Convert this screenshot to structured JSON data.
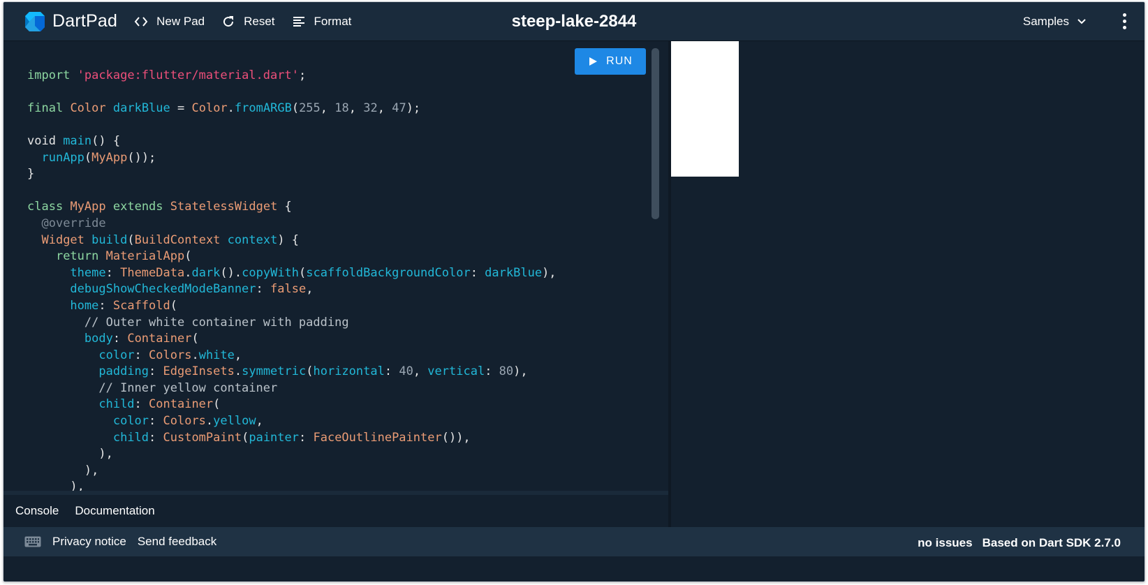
{
  "header": {
    "app_name": "DartPad",
    "new_pad": "New Pad",
    "reset": "Reset",
    "format": "Format",
    "pad_title": "steep-lake-2844",
    "samples": "Samples"
  },
  "editor": {
    "run_label": "RUN",
    "code_lines": [
      "import 'package:flutter/material.dart';",
      "",
      "final Color darkBlue = Color.fromARGB(255, 18, 32, 47);",
      "",
      "void main() {",
      "  runApp(MyApp());",
      "}",
      "",
      "class MyApp extends StatelessWidget {",
      "  @override",
      "  Widget build(BuildContext context) {",
      "    return MaterialApp(",
      "      theme: ThemeData.dark().copyWith(scaffoldBackgroundColor: darkBlue),",
      "      debugShowCheckedModeBanner: false,",
      "      home: Scaffold(",
      "        // Outer white container with padding",
      "        body: Container(",
      "          color: Colors.white,",
      "          padding: EdgeInsets.symmetric(horizontal: 40, vertical: 80),",
      "          // Inner yellow container",
      "          child: Container(",
      "            color: Colors.yellow,",
      "            child: CustomPaint(painter: FaceOutlinePainter()),",
      "          ),",
      "        ),",
      "      ),",
      "    );"
    ]
  },
  "console": {
    "tabs": [
      "Console",
      "Documentation"
    ]
  },
  "footer": {
    "privacy": "Privacy notice",
    "feedback": "Send feedback",
    "issues": "no issues",
    "sdk": "Based on Dart SDK 2.7.0"
  },
  "colors": {
    "background": "#13202e",
    "header": "#1a2b3c",
    "footer": "#1f3244",
    "run_button": "#1e88e5"
  }
}
